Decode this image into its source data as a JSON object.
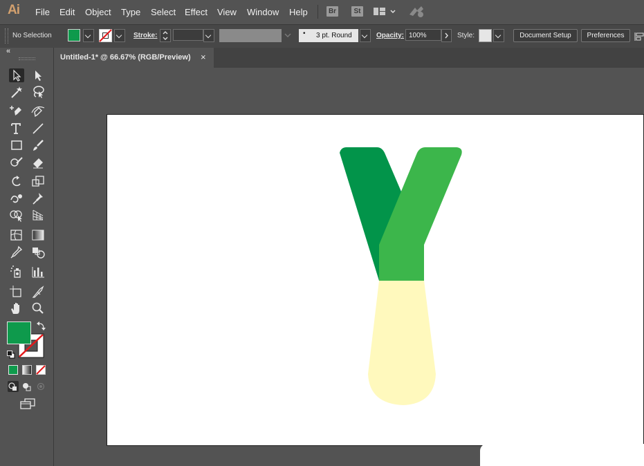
{
  "app": {
    "logo": "Ai"
  },
  "menu": [
    "File",
    "Edit",
    "Object",
    "Type",
    "Select",
    "Effect",
    "View",
    "Window",
    "Help"
  ],
  "menubar_buttons": {
    "bridge": "Br",
    "stock": "St"
  },
  "control_bar": {
    "selection_label": "No Selection",
    "fill_color": "#0e9a4c",
    "stroke_label": "Stroke:",
    "brush_label": "3 pt. Round",
    "opacity_label": "Opacity:",
    "opacity_value": "100%",
    "style_label": "Style:",
    "doc_setup": "Document Setup",
    "preferences": "Preferences"
  },
  "document": {
    "tab_title": "Untitled-1* @ 66.67% (RGB/Preview)",
    "close_glyph": "×"
  },
  "toolbox": {
    "collapse_glyph": "«",
    "fill_color": "#0e9a4c"
  },
  "artwork": {
    "left_arm_color": "#02944a",
    "right_arm_color": "#3cb64b",
    "bulb_color": "#fff9bd"
  }
}
